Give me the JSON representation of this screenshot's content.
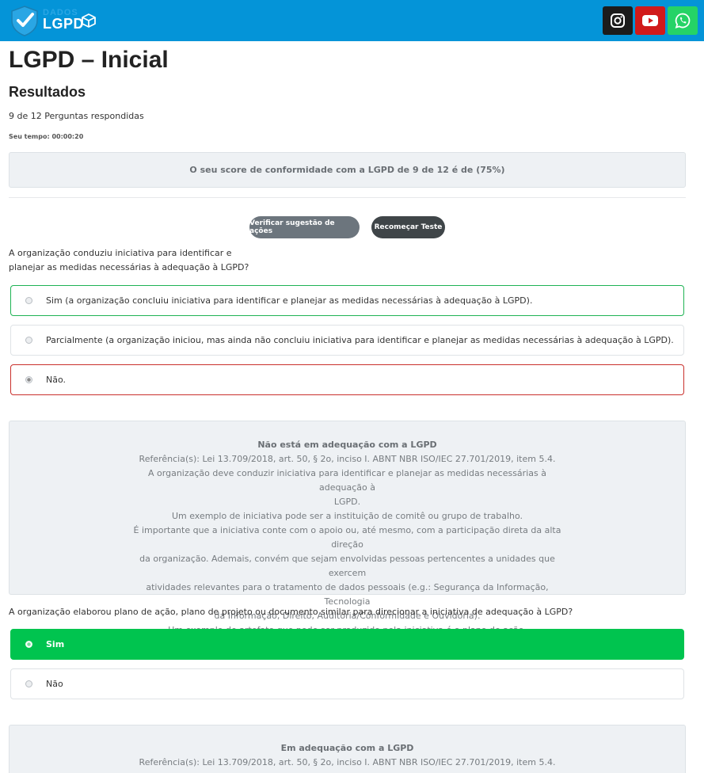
{
  "header": {
    "logo": {
      "top": "DADOS",
      "bottom": "LGPD"
    },
    "social": [
      {
        "name": "instagram",
        "icon": "instagram-icon",
        "color": "#1c1c1c"
      },
      {
        "name": "youtube",
        "icon": "youtube-icon",
        "color": "#d11a1a"
      },
      {
        "name": "whatsapp",
        "icon": "whatsapp-icon",
        "color": "#25d366"
      }
    ],
    "bar_color": "#0494d8"
  },
  "page": {
    "title": "LGPD – Inicial",
    "results_title": "Resultados",
    "answered": "9 de 12 Perguntas respondidas",
    "time": "Seu tempo: 00:00:20",
    "score": "O seu score de conformidade com a LGPD de 9 de 12 é de (75%)"
  },
  "buttons": {
    "suggest": "Verificar sugestão de ações",
    "restart": "Recomeçar Teste"
  },
  "questions": [
    {
      "text_lines": [
        "A organização conduziu iniciativa para identificar e",
        "planejar as medidas necessárias à adequação à LGPD?"
      ],
      "options": [
        {
          "label": "Sim (a organização concluiu iniciativa para identificar e planejar as medidas necessárias à adequação à LGPD).",
          "state": "correct"
        },
        {
          "label": "Parcialmente (a organização iniciou, mas ainda não concluiu iniciativa para identificar e planejar as medidas necessárias à adequação à LGPD).",
          "state": "normal"
        },
        {
          "label": "Não.",
          "state": "wrong-selected"
        }
      ],
      "feedback": {
        "title": "Não está em adequação com a LGPD",
        "lines": [
          "Referência(s): Lei 13.709/2018, art. 50, § 2o, inciso I. ABNT NBR ISO/IEC 27.701/2019, item 5.4.",
          "A organização deve conduzir iniciativa para identificar e planejar as medidas necessárias à adequação à",
          "LGPD.",
          "Um exemplo de iniciativa pode ser a instituição de comitê ou grupo de trabalho.",
          "É importante que a iniciativa conte com o apoio ou, até mesmo, com a participação direta da alta direção",
          "da organização. Ademais, convém que sejam envolvidas pessoas pertencentes a unidades que exercem",
          "atividades relevantes para o tratamento de dados pessoais (e.g.: Segurança da Informação, Tecnologia",
          "da Informação, Direito, Auditoria/Conformidade e Ouvidoria).",
          "Um exemplo de artefato que pode ser produzido pela iniciativa é o plano de ação."
        ]
      }
    },
    {
      "text_lines": [
        "A organização elaborou plano de ação, plano de projeto ou documento similar para direcionar a iniciativa de adequação à LGPD?"
      ],
      "options": [
        {
          "label": "Sim",
          "state": "chosen-right"
        },
        {
          "label": "Não",
          "state": "normal"
        }
      ],
      "feedback": {
        "title": "Em adequação com a LGPD",
        "lines": [
          "Referência(s): Lei 13.709/2018, art. 50, § 2o, inciso I. ABNT NBR ISO/IEC 27.701/2019, item 5.4."
        ]
      }
    }
  ]
}
